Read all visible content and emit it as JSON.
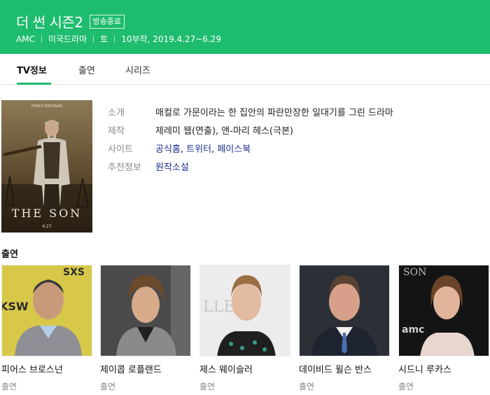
{
  "header": {
    "title": "더 썬 시즌2",
    "badge": "방송종료",
    "meta": [
      "AMC",
      "미국드라마",
      "토",
      "10부작, 2019.4.27~6.29"
    ]
  },
  "tabs": [
    {
      "label": "TV정보",
      "active": true
    },
    {
      "label": "출연",
      "active": false
    },
    {
      "label": "시리즈",
      "active": false
    }
  ],
  "poster": {
    "top_text": "PIERCE BROSNAN",
    "title_text": "THE SON",
    "date_text": "4.27"
  },
  "info": {
    "intro_label": "소개",
    "intro_value": "매컬로 가문이라는 한 집안의 파란만장한 일대기를 그린 드라마",
    "production_label": "제작",
    "production_value": "제레미 웹(연출), 앤-마리 헤스(극본)",
    "site_label": "사이트",
    "site_links": [
      "공식홈",
      "트위터",
      "페이스북"
    ],
    "recommend_label": "추천정보",
    "recommend_link": "원작소설"
  },
  "cast": {
    "title": "출연",
    "members": [
      {
        "name": "피어스 브로스넌",
        "role": "출연"
      },
      {
        "name": "제이콥 로플랜드",
        "role": "출연"
      },
      {
        "name": "제스 웨이슬러",
        "role": "출연"
      },
      {
        "name": "데이비드 윌슨 반스",
        "role": "출연"
      },
      {
        "name": "시드니 루카스",
        "role": "출연"
      }
    ]
  },
  "colors": {
    "accent": "#1ebc6e",
    "link": "#1d2e8c"
  }
}
